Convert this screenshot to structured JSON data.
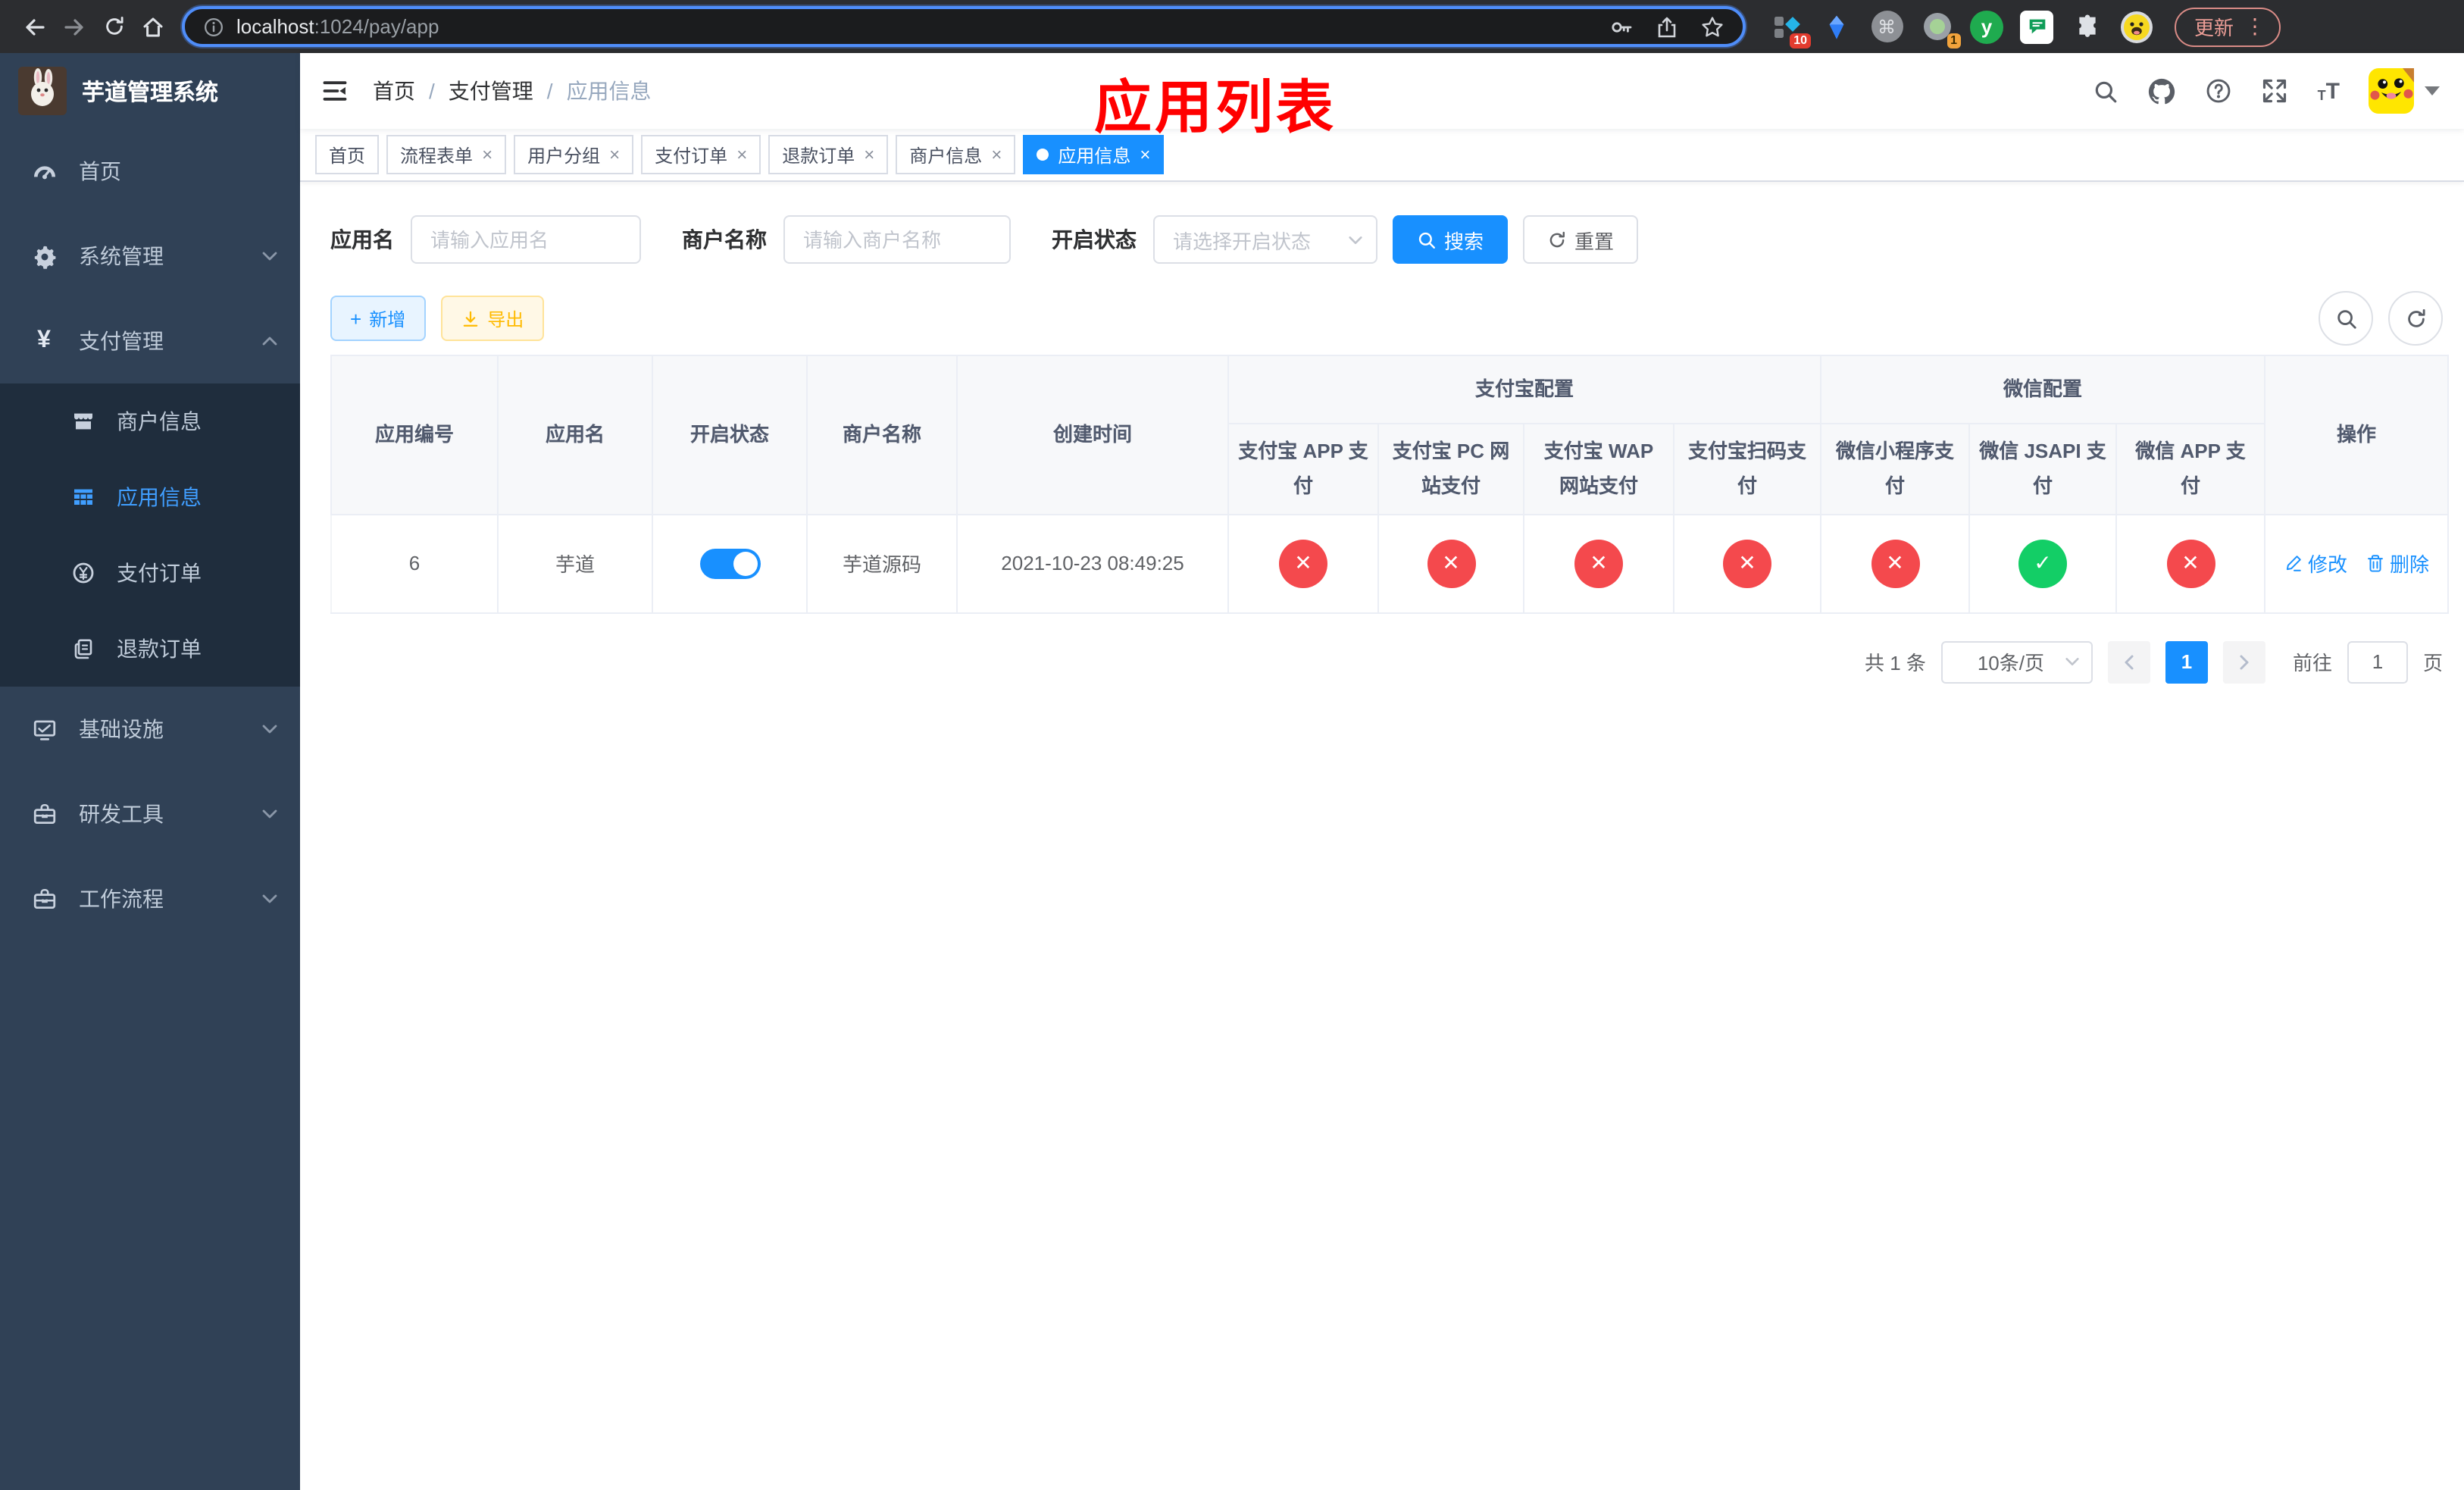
{
  "browser": {
    "url_host": "localhost",
    "url_path": ":1024/pay/app",
    "update": "更新",
    "badge_a": "10",
    "badge_b": "1"
  },
  "sidebar": {
    "title": "芋道管理系统",
    "menu": {
      "home": "首页",
      "system": "系统管理",
      "payment": "支付管理",
      "infrastructure": "基础设施",
      "devtools": "研发工具",
      "workflow": "工作流程"
    },
    "submenu": {
      "merchant": "商户信息",
      "app": "应用信息",
      "order": "支付订单",
      "refund": "退款订单"
    }
  },
  "header": {
    "breadcrumb": {
      "home": "首页",
      "payment": "支付管理",
      "current": "应用信息"
    },
    "annotation": "应用列表"
  },
  "tags": {
    "items": [
      {
        "label": "首页",
        "state": "normal"
      },
      {
        "label": "流程表单",
        "state": "normal"
      },
      {
        "label": "用户分组",
        "state": "normal"
      },
      {
        "label": "支付订单",
        "state": "normal"
      },
      {
        "label": "退款订单",
        "state": "normal"
      },
      {
        "label": "商户信息",
        "state": "normal"
      },
      {
        "label": "应用信息",
        "state": "active"
      }
    ]
  },
  "filters": {
    "app_name": {
      "label": "应用名",
      "placeholder": "请输入应用名"
    },
    "merchant_name": {
      "label": "商户名称",
      "placeholder": "请输入商户名称"
    },
    "status": {
      "label": "开启状态",
      "placeholder": "请选择开启状态"
    },
    "search": "搜索",
    "reset": "重置"
  },
  "toolbar": {
    "add": "新增",
    "export": "导出"
  },
  "table": {
    "columns": {
      "app_id": "应用编号",
      "app_name": "应用名",
      "status": "开启状态",
      "merchant_name": "商户名称",
      "create_time": "创建时间",
      "alipay_group": "支付宝配置",
      "wechat_group": "微信配置",
      "actions": "操作"
    },
    "pay_columns": [
      "支付宝 APP 支付",
      "支付宝 PC 网站支付",
      "支付宝 WAP 网站支付",
      "支付宝扫码支付",
      "微信小程序支付",
      "微信 JSAPI 支付",
      "微信 APP 支付"
    ],
    "rows": [
      {
        "app_id": "6",
        "app_name": "芋道",
        "status": "on",
        "merchant_name": "芋道源码",
        "create_time": "2021-10-23 08:49:25",
        "pay_status": [
          "fail",
          "fail",
          "fail",
          "fail",
          "fail",
          "success",
          "fail"
        ],
        "actions": {
          "edit": "修改",
          "delete": "删除"
        }
      }
    ]
  },
  "pagination": {
    "total": "共 1 条",
    "page_size": "10条/页",
    "page": "1",
    "goto": "前往",
    "goto_value": "1",
    "unit": "页"
  },
  "colors": {
    "primary": "#1890ff",
    "menu_active": "#409eff",
    "success": "#13ce66",
    "danger": "#f4494d",
    "warning": "#ffba00",
    "annotation": "#ff0000",
    "sidebar_bg": "#304156",
    "submenu_bg": "#1f2d3d"
  },
  "icons": {
    "close_glyph": "✕",
    "check_glyph": "✓",
    "tab_close": "×",
    "command_glyph": "⌘",
    "yen_glyph": "¥",
    "home_glyph": "⌂",
    "star_glyph": "☆",
    "kebab_glyph": "⋮",
    "y_ext_glyph": "y"
  }
}
